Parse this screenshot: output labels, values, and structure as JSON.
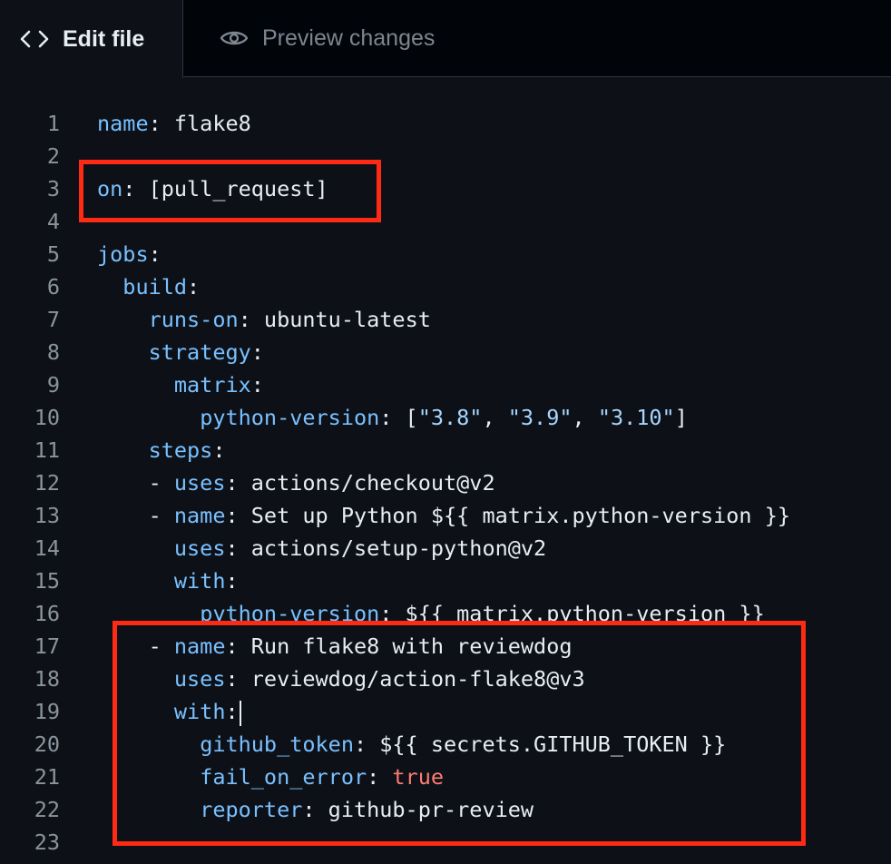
{
  "tabs": {
    "edit": {
      "label": "Edit file",
      "icon": "code-icon"
    },
    "preview": {
      "label": "Preview changes",
      "icon": "eye-icon"
    }
  },
  "editor": {
    "lines": [
      {
        "n": "1",
        "tokens": [
          {
            "t": "name",
            "c": "k"
          },
          {
            "t": ": flake8"
          }
        ]
      },
      {
        "n": "2",
        "tokens": []
      },
      {
        "n": "3",
        "tokens": [
          {
            "t": "on",
            "c": "k"
          },
          {
            "t": ": [pull_request]"
          }
        ]
      },
      {
        "n": "4",
        "tokens": []
      },
      {
        "n": "5",
        "tokens": [
          {
            "t": "jobs",
            "c": "k"
          },
          {
            "t": ":"
          }
        ]
      },
      {
        "n": "6",
        "tokens": [
          {
            "t": "  "
          },
          {
            "t": "build",
            "c": "k"
          },
          {
            "t": ":"
          }
        ]
      },
      {
        "n": "7",
        "tokens": [
          {
            "t": "    "
          },
          {
            "t": "runs-on",
            "c": "k"
          },
          {
            "t": ": ubuntu-latest"
          }
        ]
      },
      {
        "n": "8",
        "tokens": [
          {
            "t": "    "
          },
          {
            "t": "strategy",
            "c": "k"
          },
          {
            "t": ":"
          }
        ]
      },
      {
        "n": "9",
        "tokens": [
          {
            "t": "      "
          },
          {
            "t": "matrix",
            "c": "k"
          },
          {
            "t": ":"
          }
        ]
      },
      {
        "n": "10",
        "tokens": [
          {
            "t": "        "
          },
          {
            "t": "python-version",
            "c": "k"
          },
          {
            "t": ": ["
          },
          {
            "t": "\"3.8\"",
            "c": "s"
          },
          {
            "t": ", "
          },
          {
            "t": "\"3.9\"",
            "c": "s"
          },
          {
            "t": ", "
          },
          {
            "t": "\"3.10\"",
            "c": "s"
          },
          {
            "t": "]"
          }
        ]
      },
      {
        "n": "11",
        "tokens": [
          {
            "t": "    "
          },
          {
            "t": "steps",
            "c": "k"
          },
          {
            "t": ":"
          }
        ]
      },
      {
        "n": "12",
        "tokens": [
          {
            "t": "    - "
          },
          {
            "t": "uses",
            "c": "k"
          },
          {
            "t": ": actions/checkout@v2"
          }
        ]
      },
      {
        "n": "13",
        "tokens": [
          {
            "t": "    - "
          },
          {
            "t": "name",
            "c": "k"
          },
          {
            "t": ": Set up Python ${{ matrix.python-version }}"
          }
        ]
      },
      {
        "n": "14",
        "tokens": [
          {
            "t": "      "
          },
          {
            "t": "uses",
            "c": "k"
          },
          {
            "t": ": actions/setup-python@v2"
          }
        ]
      },
      {
        "n": "15",
        "tokens": [
          {
            "t": "      "
          },
          {
            "t": "with",
            "c": "k"
          },
          {
            "t": ":"
          }
        ]
      },
      {
        "n": "16",
        "tokens": [
          {
            "t": "        "
          },
          {
            "t": "python-version",
            "c": "k"
          },
          {
            "t": ": ${{ matrix.python-version }}"
          }
        ]
      },
      {
        "n": "17",
        "tokens": [
          {
            "t": "    - "
          },
          {
            "t": "name",
            "c": "k"
          },
          {
            "t": ": Run flake8 with reviewdog"
          }
        ]
      },
      {
        "n": "18",
        "tokens": [
          {
            "t": "      "
          },
          {
            "t": "uses",
            "c": "k"
          },
          {
            "t": ": reviewdog/action-flake8@v3"
          }
        ]
      },
      {
        "n": "19",
        "tokens": [
          {
            "t": "      "
          },
          {
            "t": "with",
            "c": "k"
          },
          {
            "t": ":"
          }
        ],
        "cursor": true
      },
      {
        "n": "20",
        "tokens": [
          {
            "t": "        "
          },
          {
            "t": "github_token",
            "c": "k"
          },
          {
            "t": ": ${{ secrets.GITHUB_TOKEN }}"
          }
        ]
      },
      {
        "n": "21",
        "tokens": [
          {
            "t": "        "
          },
          {
            "t": "fail_on_error",
            "c": "k"
          },
          {
            "t": ": "
          },
          {
            "t": "true",
            "c": "c"
          }
        ]
      },
      {
        "n": "22",
        "tokens": [
          {
            "t": "        "
          },
          {
            "t": "reporter",
            "c": "k"
          },
          {
            "t": ": github-pr-review"
          }
        ]
      },
      {
        "n": "23",
        "tokens": []
      }
    ]
  },
  "colors": {
    "key": "#79c0ff",
    "string": "#a5d6ff",
    "constant": "#ff7b72",
    "text": "#e6edf3",
    "line_number": "#8b949e",
    "highlight_box": "#ff2a13",
    "background": "#0d1117"
  }
}
